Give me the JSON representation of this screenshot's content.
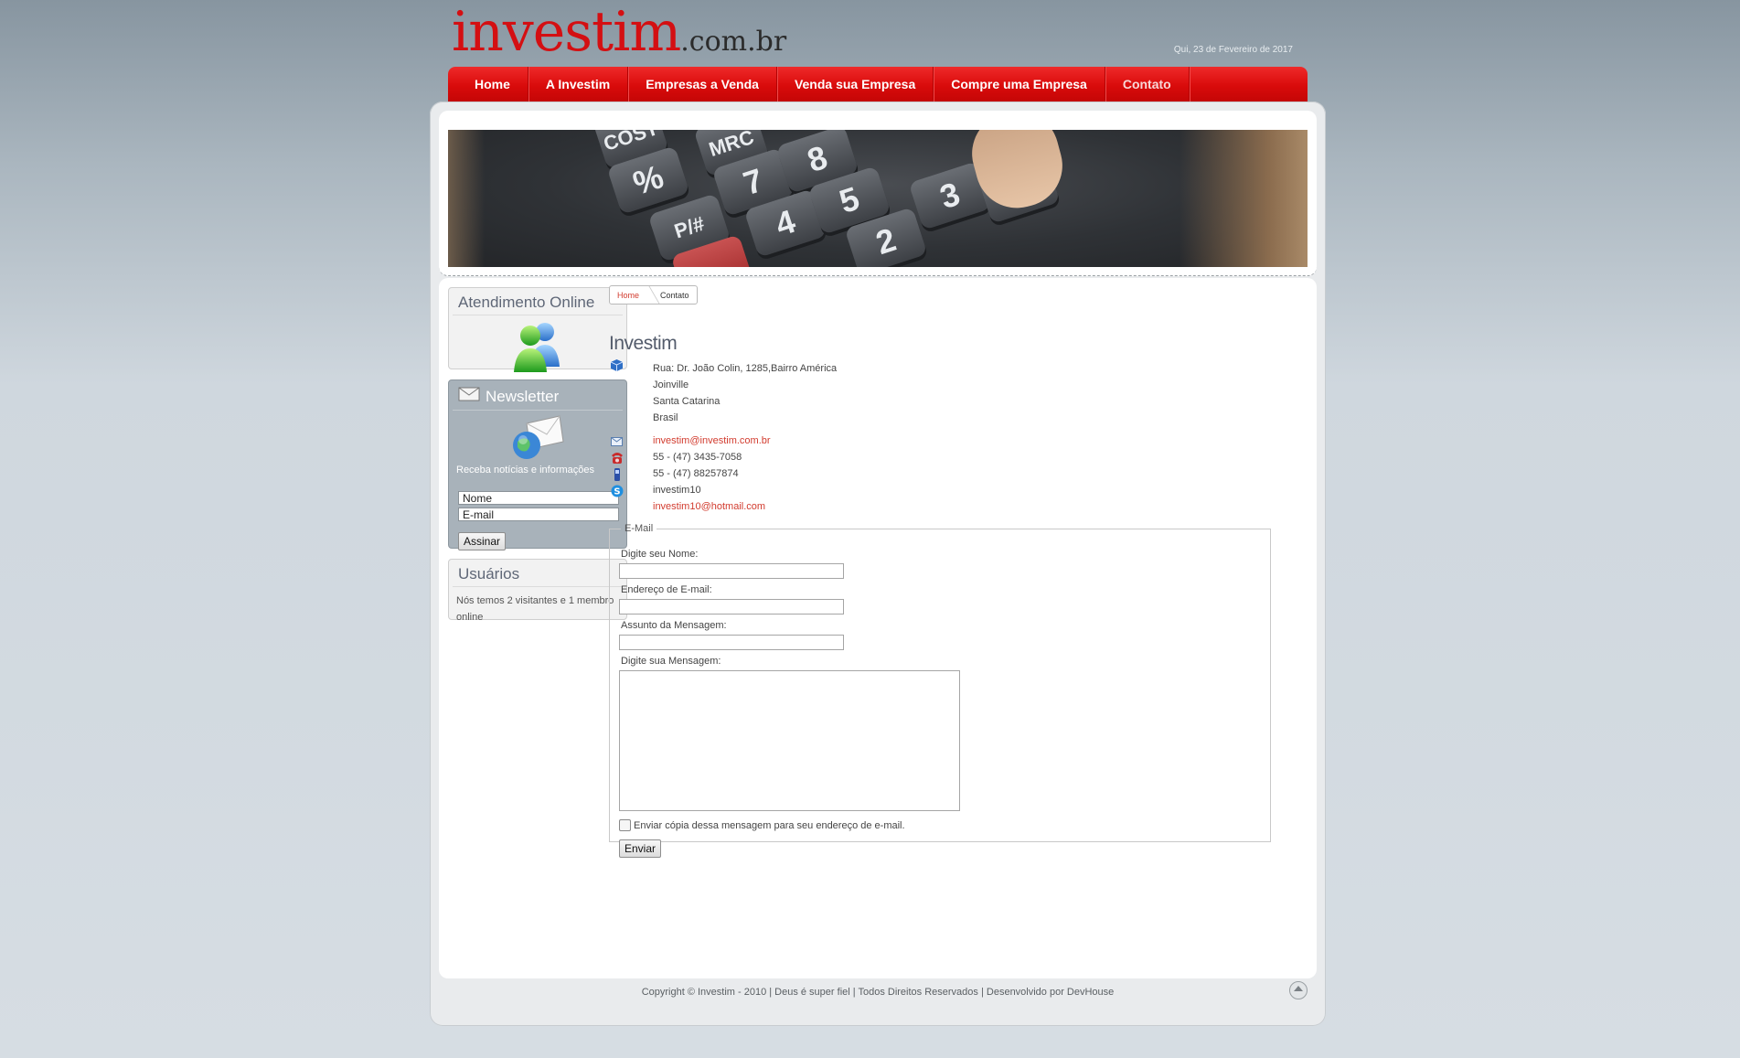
{
  "header": {
    "logo_main": "investim",
    "logo_suffix": ".com.br",
    "date": "Qui, 23 de Fevereiro de 2017"
  },
  "nav": {
    "items": [
      "Home",
      "A Investim",
      "Empresas a Venda",
      "Venda sua Empresa",
      "Compre uma Empresa",
      "Contato"
    ],
    "active": "Contato"
  },
  "sidebar": {
    "online": {
      "title": "Atendimento Online",
      "icon": "messenger-users-icon"
    },
    "newsletter": {
      "title": "Newsletter",
      "text": "Receba notícias e informações",
      "name_value": "Nome",
      "email_value": "E-mail",
      "submit": "Assinar"
    },
    "users": {
      "title": "Usuários",
      "text": "Nós temos 2 visitantes e 1 membro online"
    }
  },
  "breadcrumb": {
    "home": "Home",
    "current": "Contato"
  },
  "contact": {
    "title": "Investim",
    "address": [
      "Rua: Dr. João Colin, 1285,Bairro América",
      "Joinville",
      "Santa Catarina",
      "Brasil"
    ],
    "email": "investim@investim.com.br",
    "phone": "55 - (47) 3435-7058",
    "mobile": "55 - (47) 88257874",
    "skype": "investim10",
    "msn": "investim10@hotmail.com"
  },
  "form": {
    "legend": "E-Mail",
    "name_label": "Digite seu Nome:",
    "email_label": "Endereço de E-mail:",
    "subject_label": "Assunto da Mensagem:",
    "message_label": "Digite sua Mensagem:",
    "copy_label": "Enviar cópia dessa mensagem para seu endereço de e-mail.",
    "submit": "Enviar"
  },
  "footer": {
    "text": "Copyright © Investim - 2010 | Deus é super fiel | Todos Direitos Reservados | Desenvolvido por DevHouse"
  }
}
